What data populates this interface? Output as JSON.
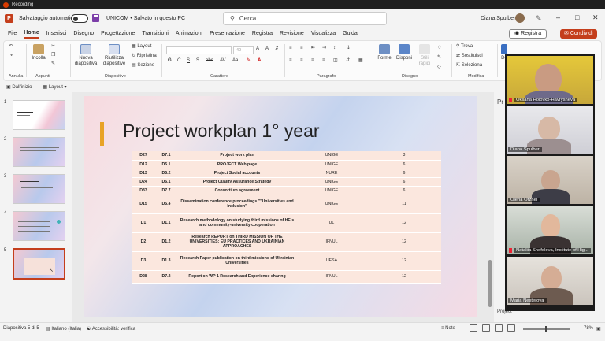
{
  "recording": {
    "label": "Recording"
  },
  "titlebar": {
    "autosave_label": "Salvataggio automatico",
    "document_title": "UNICOM • Salvato in questo PC",
    "search_placeholder": "Cerca",
    "user_name": "Diana Spulber"
  },
  "menu": {
    "tabs": [
      "File",
      "Home",
      "Inserisci",
      "Disegno",
      "Progettazione",
      "Transizioni",
      "Animazioni",
      "Presentazione",
      "Registra",
      "Revisione",
      "Visualizza",
      "Guida"
    ],
    "active": "Home",
    "record_button": "Registra",
    "share_button": "Condividi"
  },
  "ribbon": {
    "groups": {
      "undo": "Annulla",
      "clipboard": "Appunti",
      "slides": "Diapositive",
      "font": "Carattere",
      "paragraph": "Paragrafo",
      "drawing": "Disegno",
      "editing": "Modifica"
    },
    "buttons": {
      "paste": "Incolla",
      "new_slide": "Nuova diapositiva",
      "reuse_slides": "Riutilizza diapositive",
      "layout": "Layout",
      "reset": "Ripristina",
      "section": "Sezione",
      "shapes": "Forme",
      "arrange": "Disponi",
      "quick_styles": "Stili rapidi",
      "find": "Trova",
      "replace": "Sostituisci",
      "select": "Seleziona",
      "dictate_short": "De"
    },
    "font_size": "40"
  },
  "quick_access": {
    "from_start": "Dall'inizio",
    "layout": "Layout"
  },
  "thumbnails": {
    "numbers": [
      "1",
      "2",
      "3",
      "4",
      "5"
    ],
    "selected": "5"
  },
  "slide": {
    "title": "Project workplan 1° year",
    "rows": [
      {
        "id": "D27",
        "num": "D7.1",
        "title": "Project work plan",
        "partner": "UNIGE",
        "month": "3"
      },
      {
        "id": "D12",
        "num": "D5.1",
        "title": "PROJECT Web page",
        "partner": "UNIGE",
        "month": "6"
      },
      {
        "id": "D13",
        "num": "D5.2",
        "title": "Project Social accounts",
        "partner": "NURE",
        "month": "6"
      },
      {
        "id": "D24",
        "num": "D6.1",
        "title": "Project Quality Assurance Strategy",
        "partner": "UNIGE",
        "month": "6"
      },
      {
        "id": "D33",
        "num": "D7.7",
        "title": "Consortium agreement",
        "partner": "UNIGE",
        "month": "6"
      },
      {
        "id": "D15",
        "num": "D5.4",
        "title": "Dissemination conference proceedings \"\"Universities and Inclusion\"",
        "partner": "UNIGE",
        "month": "11"
      },
      {
        "id": "D1",
        "num": "D1.1",
        "title": "Research methodology on studying third missions of HEIs and community-university cooperation",
        "partner": "UL",
        "month": "12"
      },
      {
        "id": "D2",
        "num": "D1.2",
        "title": "Research REPORT on THIRD MISSION OF THE UNIVERSITIES: EU PRACTICES AND UKRAINIAN APPROACHES",
        "partner": "IFNUL",
        "month": "12"
      },
      {
        "id": "D3",
        "num": "D1.3",
        "title": "Research Paper publication on third missions of Ukrainian Universities",
        "partner": "UESA",
        "month": "12"
      },
      {
        "id": "D28",
        "num": "D7.2",
        "title": "Report on WP 1 Research and Experience sharing",
        "partner": "IFNUL",
        "month": "12"
      }
    ]
  },
  "right_panel": {
    "label": "Pr",
    "bottom_label": "Project"
  },
  "participants": [
    {
      "name": "Oksana Holovko-Havrysheva"
    },
    {
      "name": "Diana Spulber"
    },
    {
      "name": "Olena Orzhel"
    },
    {
      "name": "Nataliia Shofolova, Institute of Hig..."
    },
    {
      "name": "Maria Nesterova"
    }
  ],
  "statusbar": {
    "slide_info": "Diapositiva 5 di 5",
    "language": "Italiano (Italia)",
    "accessibility": "Accessibilità: verifica",
    "notes": "Note",
    "zoom": "78%"
  },
  "colors": {
    "accent": "#c43e1c",
    "title_accent": "#e8a326",
    "table_row": "#fbe7de"
  }
}
